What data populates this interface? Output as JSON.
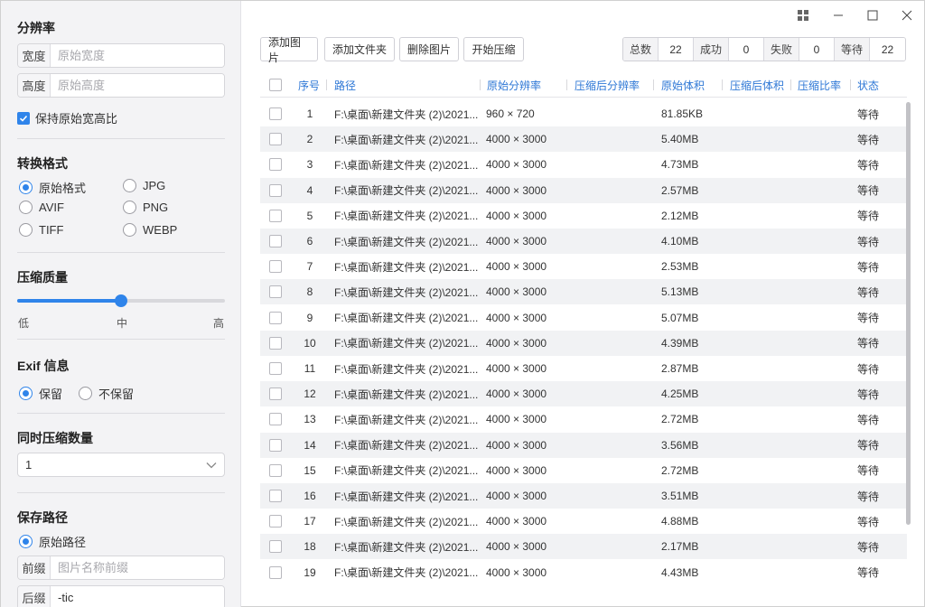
{
  "sidebar": {
    "resolution": {
      "title": "分辨率",
      "width_label": "宽度",
      "width_placeholder": "原始宽度",
      "height_label": "高度",
      "height_placeholder": "原始高度",
      "keep_ratio_label": "保持原始宽高比",
      "keep_ratio_checked": true
    },
    "format": {
      "title": "转换格式",
      "options": [
        "原始格式",
        "JPG",
        "AVIF",
        "PNG",
        "TIFF",
        "WEBP"
      ],
      "selected": "原始格式"
    },
    "quality": {
      "title": "压缩质量",
      "labels": [
        "低",
        "中",
        "高"
      ],
      "level": 0.5
    },
    "exif": {
      "title": "Exif 信息",
      "options": [
        "保留",
        "不保留"
      ],
      "selected": "保留"
    },
    "concurrency": {
      "title": "同时压缩数量",
      "value": "1"
    },
    "save_path": {
      "title": "保存路径",
      "option_label": "原始路径",
      "prefix_label": "前缀",
      "prefix_placeholder": "图片名称前缀",
      "suffix_label": "后缀",
      "suffix_value": "-tic"
    }
  },
  "toolbar": {
    "add_image": "添加图片",
    "add_folder": "添加文件夹",
    "delete_image": "删除图片",
    "start": "开始压缩"
  },
  "stats": {
    "total_label": "总数",
    "total": "22",
    "success_label": "成功",
    "success": "0",
    "fail_label": "失败",
    "fail": "0",
    "waiting_label": "等待",
    "waiting": "22"
  },
  "table": {
    "headers": [
      "序号",
      "路径",
      "原始分辨率",
      "压缩后分辨率",
      "原始体积",
      "压缩后体积",
      "压缩比率",
      "状态"
    ],
    "rows": [
      {
        "no": "1",
        "path": "F:\\桌面\\新建文件夹 (2)\\2021...",
        "res": "960 × 720",
        "size": "81.85KB",
        "status": "等待"
      },
      {
        "no": "2",
        "path": "F:\\桌面\\新建文件夹 (2)\\2021...",
        "res": "4000 × 3000",
        "size": "5.40MB",
        "status": "等待"
      },
      {
        "no": "3",
        "path": "F:\\桌面\\新建文件夹 (2)\\2021...",
        "res": "4000 × 3000",
        "size": "4.73MB",
        "status": "等待"
      },
      {
        "no": "4",
        "path": "F:\\桌面\\新建文件夹 (2)\\2021...",
        "res": "4000 × 3000",
        "size": "2.57MB",
        "status": "等待"
      },
      {
        "no": "5",
        "path": "F:\\桌面\\新建文件夹 (2)\\2021...",
        "res": "4000 × 3000",
        "size": "2.12MB",
        "status": "等待"
      },
      {
        "no": "6",
        "path": "F:\\桌面\\新建文件夹 (2)\\2021...",
        "res": "4000 × 3000",
        "size": "4.10MB",
        "status": "等待"
      },
      {
        "no": "7",
        "path": "F:\\桌面\\新建文件夹 (2)\\2021...",
        "res": "4000 × 3000",
        "size": "2.53MB",
        "status": "等待"
      },
      {
        "no": "8",
        "path": "F:\\桌面\\新建文件夹 (2)\\2021...",
        "res": "4000 × 3000",
        "size": "5.13MB",
        "status": "等待"
      },
      {
        "no": "9",
        "path": "F:\\桌面\\新建文件夹 (2)\\2021...",
        "res": "4000 × 3000",
        "size": "5.07MB",
        "status": "等待"
      },
      {
        "no": "10",
        "path": "F:\\桌面\\新建文件夹 (2)\\2021...",
        "res": "4000 × 3000",
        "size": "4.39MB",
        "status": "等待"
      },
      {
        "no": "11",
        "path": "F:\\桌面\\新建文件夹 (2)\\2021...",
        "res": "4000 × 3000",
        "size": "2.87MB",
        "status": "等待"
      },
      {
        "no": "12",
        "path": "F:\\桌面\\新建文件夹 (2)\\2021...",
        "res": "4000 × 3000",
        "size": "4.25MB",
        "status": "等待"
      },
      {
        "no": "13",
        "path": "F:\\桌面\\新建文件夹 (2)\\2021...",
        "res": "4000 × 3000",
        "size": "2.72MB",
        "status": "等待"
      },
      {
        "no": "14",
        "path": "F:\\桌面\\新建文件夹 (2)\\2021...",
        "res": "4000 × 3000",
        "size": "3.56MB",
        "status": "等待"
      },
      {
        "no": "15",
        "path": "F:\\桌面\\新建文件夹 (2)\\2021...",
        "res": "4000 × 3000",
        "size": "2.72MB",
        "status": "等待"
      },
      {
        "no": "16",
        "path": "F:\\桌面\\新建文件夹 (2)\\2021...",
        "res": "4000 × 3000",
        "size": "3.51MB",
        "status": "等待"
      },
      {
        "no": "17",
        "path": "F:\\桌面\\新建文件夹 (2)\\2021...",
        "res": "4000 × 3000",
        "size": "4.88MB",
        "status": "等待"
      },
      {
        "no": "18",
        "path": "F:\\桌面\\新建文件夹 (2)\\2021...",
        "res": "4000 × 3000",
        "size": "2.17MB",
        "status": "等待"
      },
      {
        "no": "19",
        "path": "F:\\桌面\\新建文件夹 (2)\\2021...",
        "res": "4000 × 3000",
        "size": "4.43MB",
        "status": "等待"
      }
    ]
  },
  "window": {
    "icons": [
      "app-grid-icon",
      "minimize-icon",
      "maximize-icon",
      "close-icon"
    ]
  },
  "colors": {
    "accent": "#2f84ea",
    "header_text": "#2f78d6",
    "sidebar_bg": "#f3f3f5",
    "row_alt": "#f1f2f4"
  }
}
